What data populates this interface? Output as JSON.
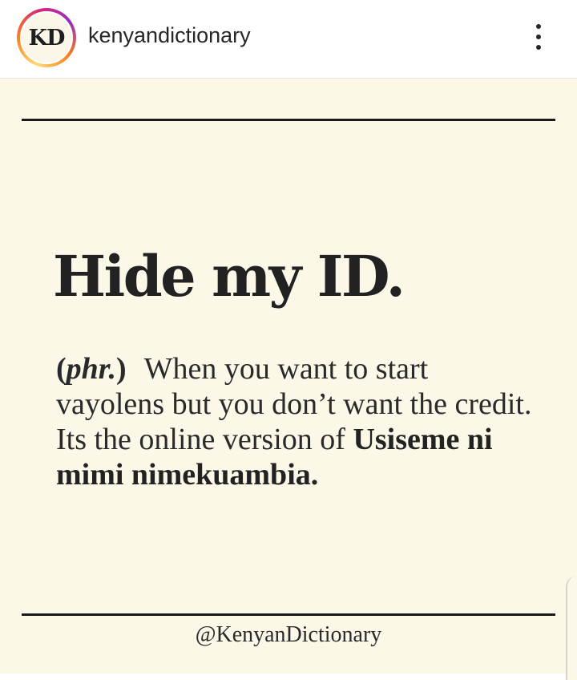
{
  "header": {
    "avatar_initials": "KD",
    "username": "kenyandictionary",
    "more_icon": "more-vertical-icon"
  },
  "post": {
    "headword": "Hide my ID.",
    "part_of_speech_open": "(",
    "part_of_speech": "phr.",
    "part_of_speech_close": ")",
    "definition": "When you want to start vayolens but you don’t want the credit. Its the online version of",
    "phrase": "Usiseme ni mimi nimekuambia.",
    "handle": "@KenyanDictionary"
  },
  "colors": {
    "post_background": "#fcf8e8",
    "text": "#222222",
    "rule": "#1a1a1a"
  }
}
